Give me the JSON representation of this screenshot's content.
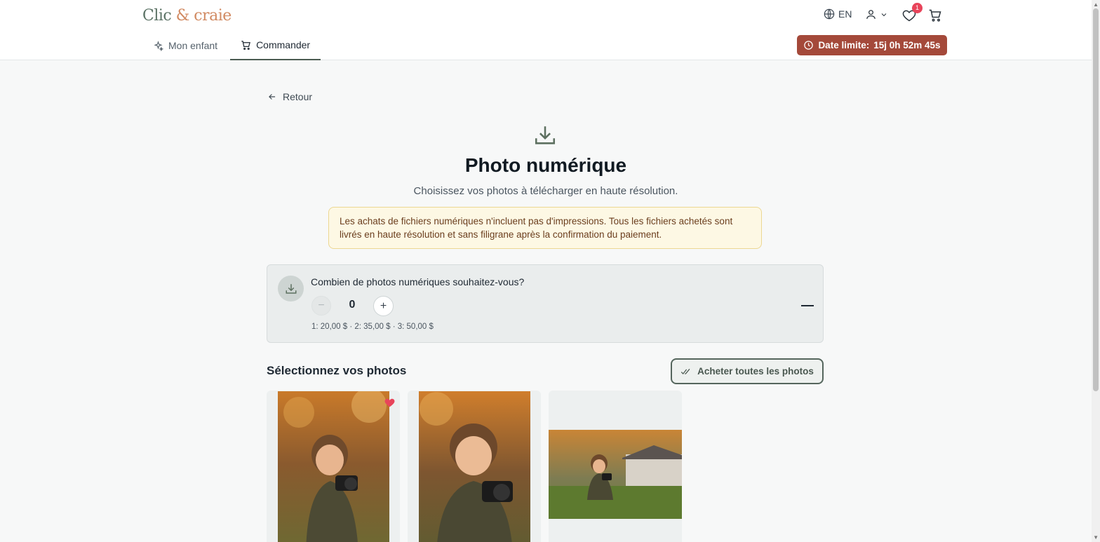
{
  "header": {
    "logo_part1": "Clic",
    "logo_part2": " & craie",
    "language": "EN",
    "favorites_count": "1",
    "nav": [
      {
        "label": "Mon enfant",
        "icon": "sparkles-icon"
      },
      {
        "label": "Commander",
        "icon": "cart-icon"
      }
    ],
    "deadline_label": "Date limite:",
    "deadline_value": "15j 0h 52m 45s"
  },
  "main": {
    "back_label": "Retour",
    "title": "Photo numérique",
    "subtitle": "Choisissez vos photos à télécharger en haute résolution.",
    "notice_line1": "Les achats de fichiers numériques n'incluent pas d'impressions. Tous les fichiers achetés sont",
    "notice_line2": "livrés en haute résolution et sans filigrane après la confirmation du paiement.",
    "quantity": {
      "question": "Combien de photos numériques souhaitez-vous?",
      "value": "0",
      "price_tiers": "1: 20,00 $ · 2: 35,00 $ · 3: 50,00 $"
    },
    "section_title": "Sélectionnez vos photos",
    "buy_all_label": "Acheter toutes les photos"
  },
  "colors": {
    "accent": "#4b5b51",
    "deadline_bg": "#a4493a",
    "notice_bg": "#fdf8e4",
    "badge": "#e8445a"
  }
}
